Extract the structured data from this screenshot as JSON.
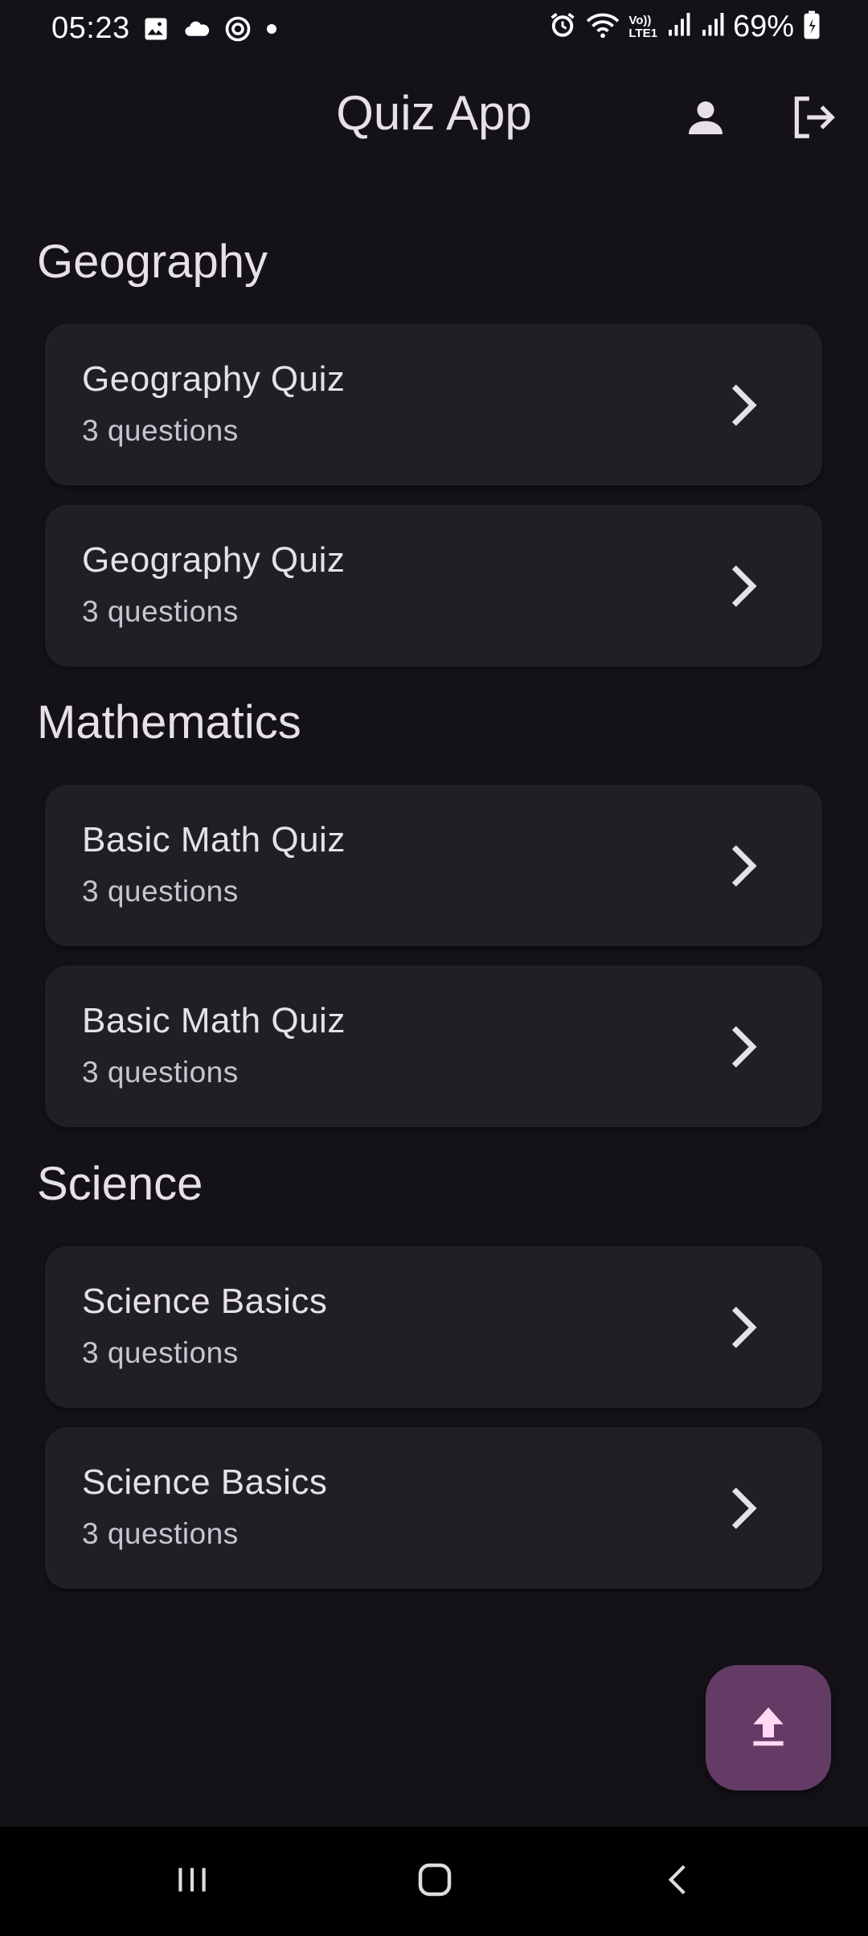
{
  "status_bar": {
    "time": "05:23",
    "battery": "69%",
    "left_icons": [
      "image-icon",
      "cloud-icon",
      "sync-icon",
      "dot-icon"
    ],
    "right_icons": [
      "alarm-icon",
      "wifi-icon",
      "volte-icon",
      "signal-icon",
      "signal-icon",
      "battery-icon"
    ],
    "volte_label_top": "Vo))",
    "volte_label_bottom": "LTE1"
  },
  "app_bar": {
    "title": "Quiz App",
    "actions": [
      "person-icon",
      "logout-icon"
    ]
  },
  "sections": [
    {
      "title": "Geography",
      "quizzes": [
        {
          "title": "Geography Quiz",
          "subtitle": "3 questions"
        },
        {
          "title": "Geography Quiz",
          "subtitle": "3 questions"
        }
      ]
    },
    {
      "title": "Mathematics",
      "quizzes": [
        {
          "title": "Basic Math Quiz",
          "subtitle": "3 questions"
        },
        {
          "title": "Basic Math Quiz",
          "subtitle": "3 questions"
        }
      ]
    },
    {
      "title": "Science",
      "quizzes": [
        {
          "title": "Science Basics",
          "subtitle": "3 questions"
        },
        {
          "title": "Science Basics",
          "subtitle": "3 questions"
        }
      ]
    }
  ],
  "fab": {
    "icon": "upload-icon"
  },
  "nav_bar": {
    "buttons": [
      "recents-icon",
      "home-icon",
      "back-icon"
    ]
  },
  "colors": {
    "background": "#141218",
    "card": "#211f26",
    "fab": "#633b64",
    "fab_icon": "#ffd8f4",
    "text_primary": "#e6e0e9",
    "text_secondary": "#cac4d0"
  }
}
